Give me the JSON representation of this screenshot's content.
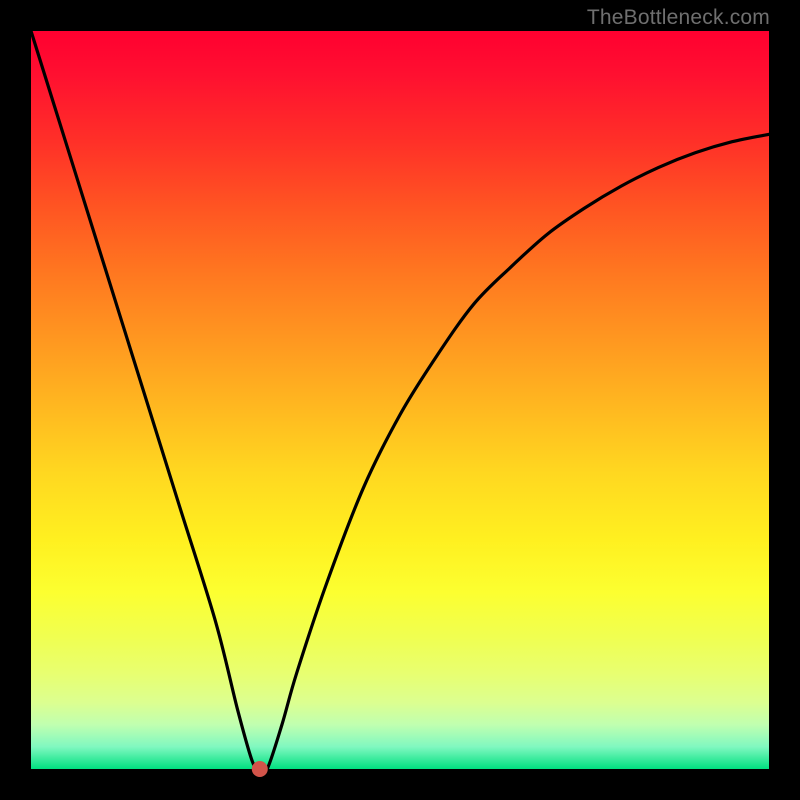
{
  "attribution": "TheBottleneck.com",
  "chart_data": {
    "type": "line",
    "title": "",
    "xlabel": "",
    "ylabel": "",
    "xlim": [
      0,
      100
    ],
    "ylim": [
      0,
      100
    ],
    "gradient_background": {
      "orientation": "vertical",
      "stops": [
        {
          "pos": 0.0,
          "color": "#ff0030"
        },
        {
          "pos": 0.5,
          "color": "#ffb820"
        },
        {
          "pos": 0.8,
          "color": "#f8ff40"
        },
        {
          "pos": 1.0,
          "color": "#00e080"
        }
      ]
    },
    "series": [
      {
        "name": "bottleneck-curve",
        "color": "#000000",
        "x": [
          0,
          5,
          10,
          15,
          20,
          25,
          28,
          30,
          31,
          32,
          34,
          36,
          40,
          45,
          50,
          55,
          60,
          65,
          70,
          75,
          80,
          85,
          90,
          95,
          100
        ],
        "values": [
          100,
          84,
          68,
          52,
          36,
          20,
          8,
          1,
          0,
          0,
          6,
          13,
          25,
          38,
          48,
          56,
          63,
          68,
          72.5,
          76,
          79,
          81.5,
          83.5,
          85,
          86
        ]
      }
    ],
    "marker": {
      "name": "min-point",
      "x": 31,
      "y": 0,
      "color": "#d2544a",
      "radius_px": 8
    }
  }
}
